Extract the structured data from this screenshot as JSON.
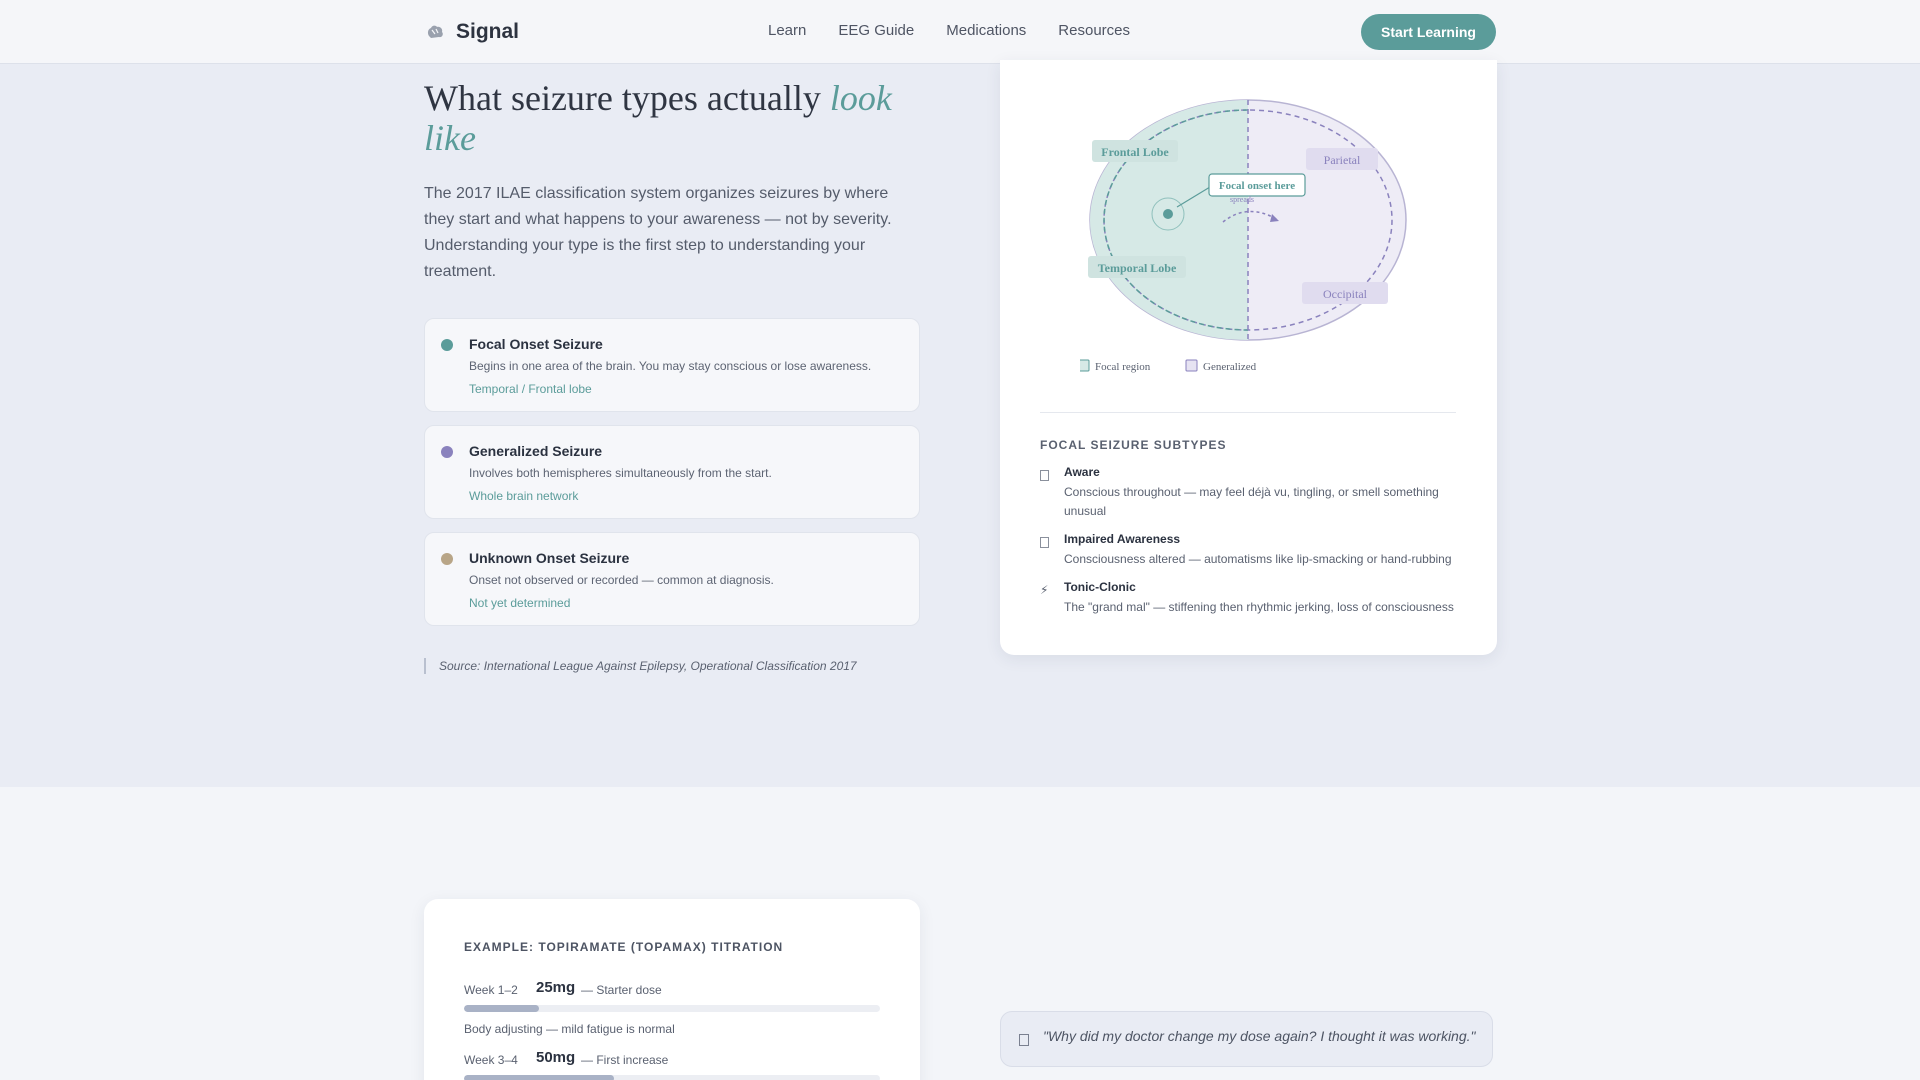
{
  "nav": {
    "brand": "Signal",
    "links": [
      "Learn",
      "EEG Guide",
      "Medications",
      "Resources"
    ],
    "cta": "Start Learning"
  },
  "hero": {
    "title_main": "What seizure types actually ",
    "title_accent": "look like",
    "description": "The 2017 ILAE classification system organizes seizures by where they start and what happens to your awareness — not by severity. Understanding your type is the first step to understanding your treatment."
  },
  "seizure_types": [
    {
      "title": "Focal Onset Seizure",
      "desc": "Begins in one area of the brain. You may stay conscious or lose awareness.",
      "tag": "Temporal / Frontal lobe",
      "color": "#5b9c9a"
    },
    {
      "title": "Generalized Seizure",
      "desc": "Involves both hemispheres simultaneously from the start.",
      "tag": "Whole brain network",
      "color": "#8a82bd"
    },
    {
      "title": "Unknown Onset Seizure",
      "desc": "Onset not observed or recorded — common at diagnosis.",
      "tag": "Not yet determined",
      "color": "#b8a587"
    }
  ],
  "source": "Source: International League Against Epilepsy, Operational Classification 2017",
  "diagram": {
    "regions": {
      "frontal": "Frontal Lobe",
      "parietal": "Parietal",
      "temporal": "Temporal Lobe",
      "occipital": "Occipital"
    },
    "callout": "Focal onset here",
    "spread_label": "spreads",
    "legend": {
      "focal": "Focal region",
      "generalized": "Generalized"
    },
    "colors": {
      "focal": "#5b9c9a",
      "generalized": "#8a82bd"
    }
  },
  "subtypes": {
    "heading": "FOCAL SEIZURE SUBTYPES",
    "items": [
      {
        "title": "Aware",
        "desc": "Conscious throughout — may feel déjà vu, tingling, or smell something unusual",
        "icon": "square-icon"
      },
      {
        "title": "Impaired Awareness",
        "desc": "Consciousness altered — automatisms like lip-smacking or hand-rubbing",
        "icon": "square-icon"
      },
      {
        "title": "Tonic-Clonic",
        "desc": "The \"grand mal\" — stiffening then rhythmic jerking, loss of consciousness",
        "icon": "lightning-icon",
        "glyph": "⚡"
      }
    ]
  },
  "titration": {
    "heading": "EXAMPLE: TOPIRAMATE (TOPAMAX) TITRATION",
    "rows": [
      {
        "week": "Week 1–2",
        "dose": "25mg",
        "label": "— Starter dose",
        "note": "Body adjusting — mild fatigue is normal",
        "progress": 0.18
      },
      {
        "week": "Week 3–4",
        "dose": "50mg",
        "label": "— First increase",
        "note": "",
        "progress": 0.36
      }
    ]
  },
  "quote": "\"Why did my doctor change my dose again? I thought it was working.\""
}
